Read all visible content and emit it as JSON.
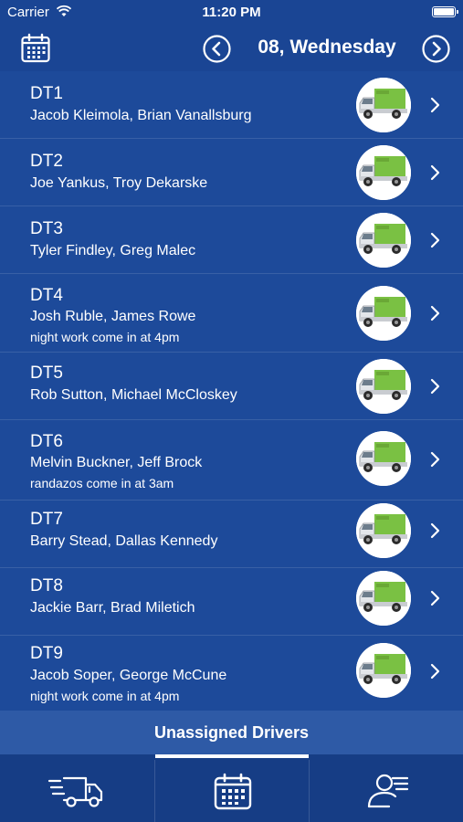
{
  "status_bar": {
    "carrier": "Carrier",
    "time": "11:20 PM"
  },
  "header": {
    "date_title": "08, Wednesday"
  },
  "crews": [
    {
      "name": "DT1",
      "drivers": "Jacob Kleimola, Brian Vanallsburg",
      "note": ""
    },
    {
      "name": "DT2",
      "drivers": "Joe Yankus, Troy Dekarske",
      "note": ""
    },
    {
      "name": "DT3",
      "drivers": "Tyler Findley, Greg Malec",
      "note": ""
    },
    {
      "name": "DT4",
      "drivers": "Josh Ruble, James Rowe",
      "note": "night work come in at 4pm"
    },
    {
      "name": "DT5",
      "drivers": "Rob Sutton, Michael McCloskey",
      "note": ""
    },
    {
      "name": "DT6",
      "drivers": "Melvin Buckner, Jeff Brock",
      "note": "randazos come in at 3am"
    },
    {
      "name": "DT7",
      "drivers": "Barry Stead, Dallas Kennedy",
      "note": ""
    },
    {
      "name": "DT8",
      "drivers": "Jackie Barr, Brad Miletich",
      "note": ""
    },
    {
      "name": "DT9",
      "drivers": "Jacob Soper, George McCune",
      "note": "night work come in at 4pm"
    }
  ],
  "unassigned": {
    "label": "Unassigned Drivers"
  },
  "tabs": [
    {
      "icon": "truck-icon",
      "active": false
    },
    {
      "icon": "calendar-icon",
      "active": true
    },
    {
      "icon": "driver-profile-icon",
      "active": false
    }
  ],
  "colors": {
    "background": "#1d4a9a",
    "bar": "#1a4594",
    "accent": "#7ac143",
    "tabbar": "#163d85"
  }
}
